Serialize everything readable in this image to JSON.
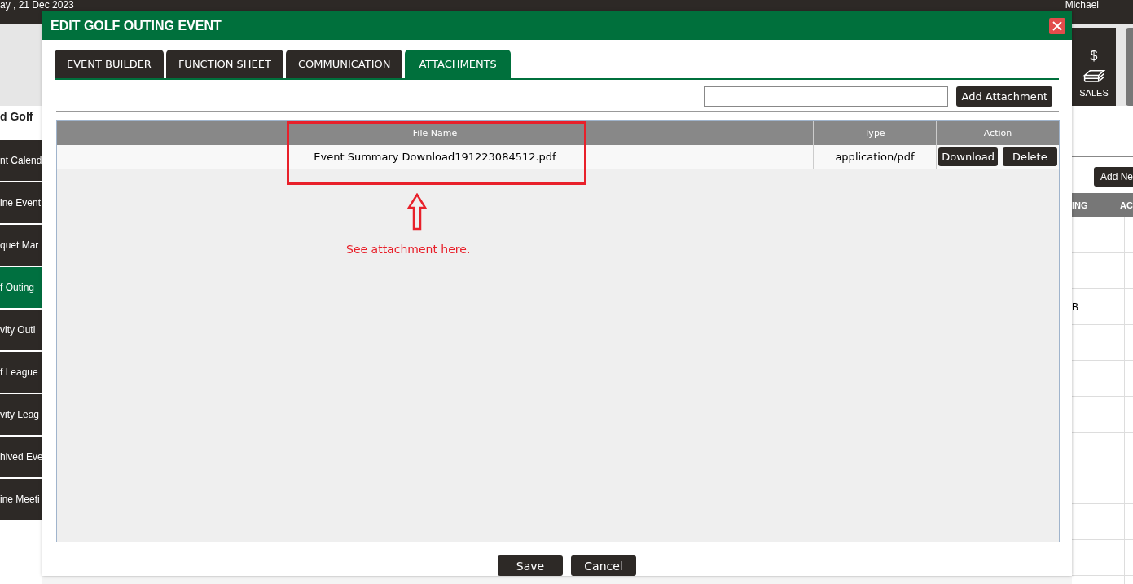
{
  "top_bar": {
    "date": "ay , 21 Dec 2023",
    "user": "Michael"
  },
  "page_title": "d Golf",
  "sidebar": {
    "items": [
      {
        "label": "nt Calend",
        "selected": false
      },
      {
        "label": "ine Event",
        "selected": false
      },
      {
        "label": "quet Mar",
        "selected": false
      },
      {
        "label": "f Outing",
        "selected": true
      },
      {
        "label": "vity Outi",
        "selected": false
      },
      {
        "label": "f League",
        "selected": false
      },
      {
        "label": "vity Leag",
        "selected": false
      },
      {
        "label": "hived Eve",
        "selected": false
      },
      {
        "label": "ine Meeti",
        "selected": false
      }
    ]
  },
  "sales_tile": {
    "symbol": "$",
    "label": "SALES"
  },
  "right_panel": {
    "add_button": "Add Ne",
    "columns": [
      "ING",
      "AC"
    ],
    "cell": "B"
  },
  "dialog": {
    "title": "EDIT GOLF OUTING EVENT",
    "tabs": [
      {
        "label": "EVENT BUILDER",
        "selected": false
      },
      {
        "label": "FUNCTION SHEET",
        "selected": false
      },
      {
        "label": "COMMUNICATION",
        "selected": false
      },
      {
        "label": "ATTACHMENTS",
        "selected": true
      }
    ],
    "add_attachment": "Add Attachment",
    "table": {
      "columns": [
        "File Name",
        "Type",
        "Action"
      ],
      "rows": [
        {
          "file_name": "Event Summary Download191223084512.pdf",
          "type": "application/pdf",
          "actions": [
            "Download",
            "Delete"
          ]
        }
      ]
    },
    "annotation": {
      "note": "See attachment here."
    },
    "buttons": [
      "Save",
      "Cancel"
    ]
  }
}
